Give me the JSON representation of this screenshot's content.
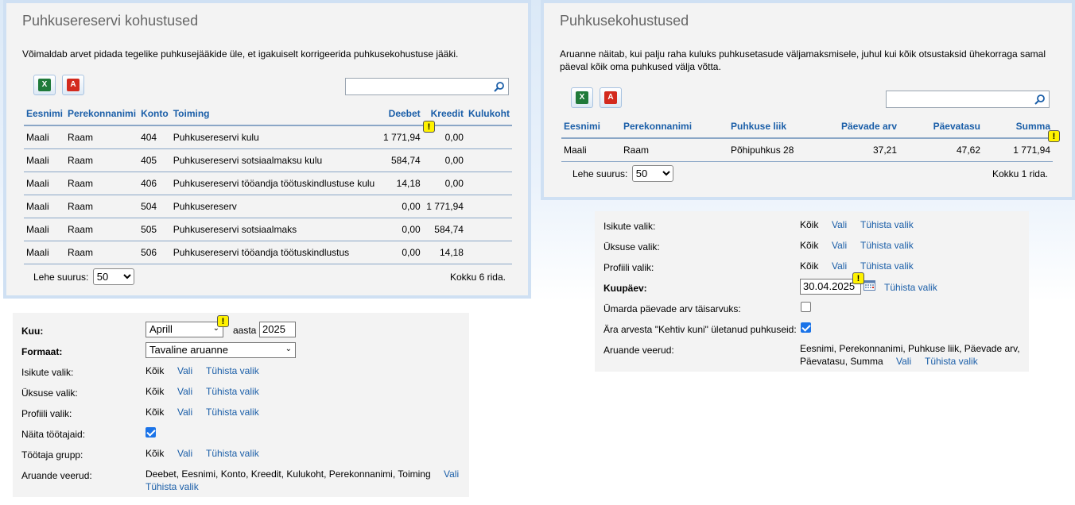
{
  "left_panel": {
    "title": "Puhkusereservi kohustused",
    "description": "Võimaldab arvet pidada tegelike puhkusejääkide üle, et igakuiselt korrigeerida puhkusekohustuse jääki.",
    "search_placeholder": "",
    "columns": [
      "Eesnimi",
      "Perekonnanimi",
      "Konto",
      "Toiming",
      "Deebet",
      "Kreedit",
      "Kulukoht"
    ],
    "rows": [
      [
        "Maali",
        "Raam",
        "404",
        "Puhkusereservi kulu",
        "1 771,94",
        "0,00",
        ""
      ],
      [
        "Maali",
        "Raam",
        "405",
        "Puhkusereservi sotsiaalmaksu kulu",
        "584,74",
        "0,00",
        ""
      ],
      [
        "Maali",
        "Raam",
        "406",
        "Puhkusereservi tööandja töötuskindlustuse kulu",
        "14,18",
        "0,00",
        ""
      ],
      [
        "Maali",
        "Raam",
        "504",
        "Puhkusereserv",
        "0,00",
        "1 771,94",
        ""
      ],
      [
        "Maali",
        "Raam",
        "505",
        "Puhkusereservi sotsiaalmaks",
        "0,00",
        "584,74",
        ""
      ],
      [
        "Maali",
        "Raam",
        "506",
        "Puhkusereservi tööandja töötuskindlustus",
        "0,00",
        "14,18",
        ""
      ]
    ],
    "page_size_label": "Lehe suurus:",
    "page_size": "50",
    "total": "Kokku 6 rida."
  },
  "right_panel": {
    "title": "Puhkusekohustused",
    "description_line1": "Aruanne näitab, kui palju raha kuluks puhkusetasude väljamaksmisele, juhul kui kõik otsustaksid ühekorraga samal",
    "description_line2": "päeval kõik oma puhkused välja võtta.",
    "search_placeholder": "",
    "columns": [
      "Eesnimi",
      "Perekonnanimi",
      "Puhkuse liik",
      "Päevade arv",
      "Päevatasu",
      "Summa"
    ],
    "rows": [
      [
        "Maali",
        "Raam",
        "Põhipuhkus 28",
        "37,21",
        "47,62",
        "1 771,94"
      ]
    ],
    "page_size_label": "Lehe suurus:",
    "page_size": "50",
    "total": "Kokku 1 rida."
  },
  "left_form": {
    "month_label": "Kuu:",
    "month_value": "Aprill",
    "year_label": "aasta",
    "year_value": "2025",
    "format_label": "Formaat:",
    "format_value": "Tavaline aruanne",
    "persons_label": "Isikute valik:",
    "unit_label": "Üksuse valik:",
    "profile_label": "Profiili valik:",
    "show_employees_label": "Näita töötajaid:",
    "employee_group_label": "Töötaja grupp:",
    "all": "Kõik",
    "choose": "Vali",
    "clear": "Tühista valik",
    "columns_label": "Aruande veerud:",
    "columns_value": "Deebet, Eesnimi, Konto, Kreedit, Kulukoht, Perekonnanimi, Toiming"
  },
  "right_form": {
    "persons_label": "Isikute valik:",
    "unit_label": "Üksuse valik:",
    "profile_label": "Profiili valik:",
    "date_label": "Kuupäev:",
    "date_value": "30.04.2025",
    "round_label": "Ümarda päevade arv täisarvuks:",
    "skip_expired_label": "Ära arvesta \"Kehtiv kuni\" ületanud puhkuseid:",
    "columns_label": "Aruande veerud:",
    "columns_value_line1": "Eesnimi, Perekonnanimi, Puhkuse liik, Päevade arv,",
    "columns_value_line2": "Päevatasu, Summa",
    "all": "Kõik",
    "choose": "Vali",
    "clear": "Tühista valik"
  },
  "warning_glyph": "!",
  "icons": [
    "excel-export-icon",
    "pdf-export-icon",
    "search-icon",
    "calendar-icon",
    "warning-icon"
  ]
}
